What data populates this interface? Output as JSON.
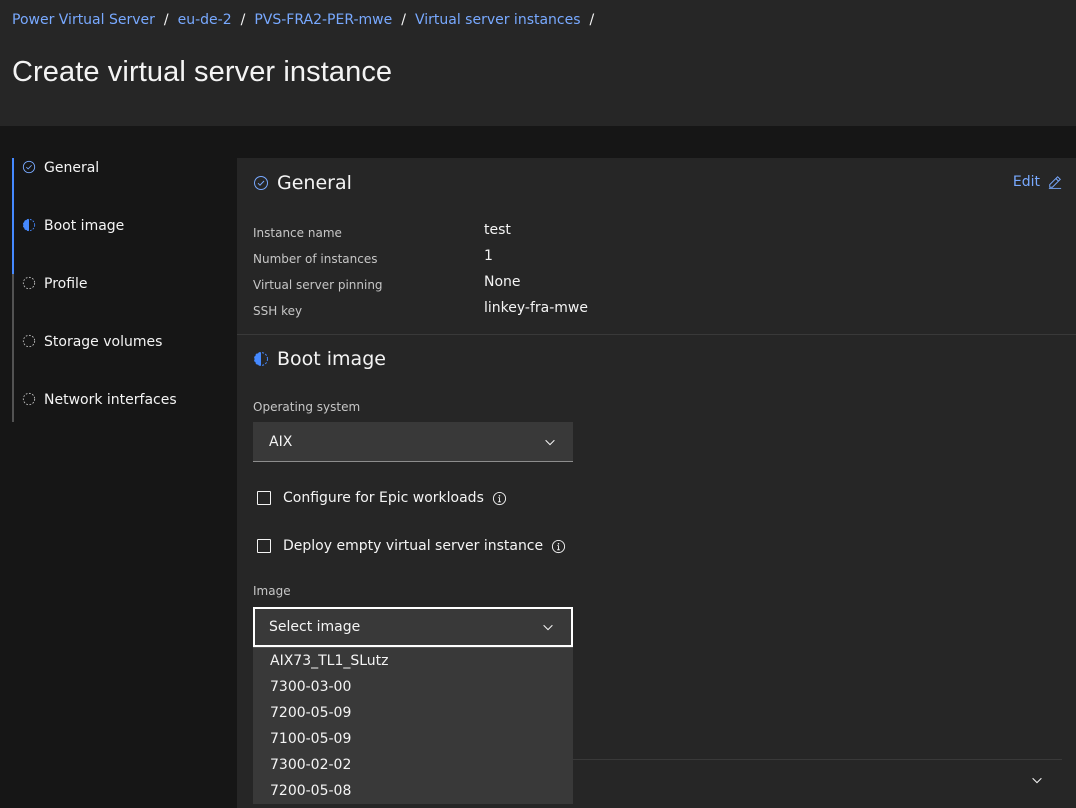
{
  "breadcrumb": [
    "Power Virtual Server",
    "eu-de-2",
    "PVS-FRA2-PER-mwe",
    "Virtual server instances"
  ],
  "breadcrumb_separator": "/",
  "page_title": "Create virtual server instance",
  "progress": [
    {
      "label": "General",
      "state": "complete"
    },
    {
      "label": "Boot image",
      "state": "current"
    },
    {
      "label": "Profile",
      "state": "incomplete"
    },
    {
      "label": "Storage volumes",
      "state": "incomplete"
    },
    {
      "label": "Network interfaces",
      "state": "incomplete"
    }
  ],
  "general": {
    "title": "General",
    "edit_label": "Edit",
    "rows": [
      {
        "key": "Instance name",
        "value": "test"
      },
      {
        "key": "Number of instances",
        "value": "1"
      },
      {
        "key": "Virtual server pinning",
        "value": "None"
      },
      {
        "key": "SSH key",
        "value": "linkey-fra-mwe"
      }
    ]
  },
  "boot_image": {
    "title": "Boot image",
    "os_label": "Operating system",
    "os_value": "AIX",
    "epic_label": "Configure for Epic workloads",
    "empty_label": "Deploy empty virtual server instance",
    "image_label": "Image",
    "image_placeholder": "Select image",
    "image_options": [
      "AIX73_TL1_SLutz",
      "7300-03-00",
      "7200-05-09",
      "7100-05-09",
      "7300-02-02",
      "7200-05-08"
    ]
  },
  "colors": {
    "accent": "#4589ff",
    "link": "#78a9ff"
  }
}
